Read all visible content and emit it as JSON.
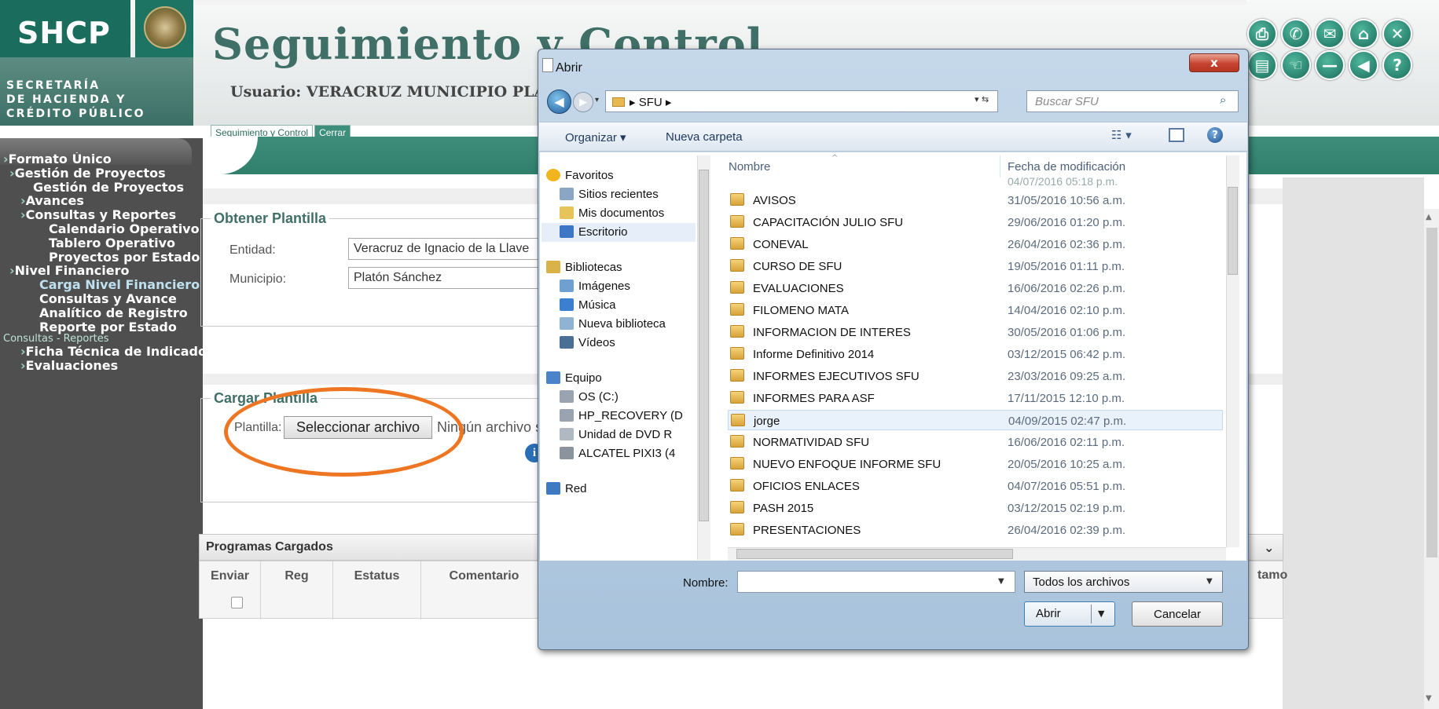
{
  "header": {
    "logo": "SHCP",
    "secretaria": [
      "SECRETARÍA",
      "DE HACIENDA Y",
      "CRÉDITO PÚBLICO"
    ],
    "app_title": "Seguimiento y Control",
    "usuario": "Usuario: VERACRUZ MUNICIPIO PLA",
    "tabs": [
      "Seguimiento y Control",
      "Cerrar"
    ]
  },
  "top_icons_row1": [
    "printer-icon",
    "phone-icon",
    "mail-icon",
    "home-icon",
    "close-icon"
  ],
  "top_icons_row2": [
    "clipboard-icon",
    "hand-pointer-icon",
    "minus-icon",
    "back-icon",
    "help-icon"
  ],
  "sidebar": {
    "items": [
      {
        "label": "Formato Único",
        "level": 1
      },
      {
        "label": "Gestión de Proyectos",
        "level": 2
      },
      {
        "label": "Gestión de Proyectos",
        "level": 3
      },
      {
        "label": "Avances",
        "level": 2
      },
      {
        "label": "Consultas y Reportes",
        "level": 2
      },
      {
        "label": "Calendario Operativo",
        "level": 3
      },
      {
        "label": "Tablero Operativo",
        "level": 3
      },
      {
        "label": "Proyectos por Estado",
        "level": 3
      },
      {
        "label": "Nivel Financiero",
        "level": 1
      },
      {
        "label": "Carga Nivel Financiero",
        "level": 3
      },
      {
        "label": "Consultas y Avance",
        "level": 3
      },
      {
        "label": "Analítico de Registro",
        "level": 3
      },
      {
        "label": "Reporte por Estado",
        "level": 3
      },
      {
        "label": "Consultas - Reportes",
        "level": 0
      },
      {
        "label": "Ficha Técnica de Indicadores",
        "level": 2
      },
      {
        "label": "Evaluaciones",
        "level": 2
      }
    ]
  },
  "obtener": {
    "legend": "Obtener Plantilla",
    "entidad_label": "Entidad:",
    "entidad_value": "Veracruz de Ignacio de la Llave",
    "municipio_label": "Municipio:",
    "municipio_value": "Platón Sánchez"
  },
  "cargar": {
    "legend": "Cargar Plantilla",
    "plantilla_label": "Plantilla:",
    "button": "Seleccionar archivo",
    "no_file": "Ningún archivo seleccionado"
  },
  "grid": {
    "title": "Programas Cargados",
    "columns": [
      "Enviar",
      "Reg",
      "Estatus",
      "Comentario"
    ],
    "last_col": "tamo"
  },
  "dialog": {
    "title": "Abrir",
    "close": "x",
    "address": "SFU",
    "search_placeholder": "Buscar SFU",
    "organize": "Organizar ▾",
    "new_folder": "Nueva carpeta",
    "nav": [
      {
        "label": "Favoritos",
        "icon": "star-icon",
        "group": true
      },
      {
        "label": "Sitios recientes",
        "icon": "recent-places-icon"
      },
      {
        "label": "Mis documentos",
        "icon": "documents-icon"
      },
      {
        "label": "Escritorio",
        "icon": "desktop-icon",
        "selected": true
      },
      {
        "label": "Bibliotecas",
        "icon": "libraries-icon",
        "group": true
      },
      {
        "label": "Imágenes",
        "icon": "pictures-icon"
      },
      {
        "label": "Música",
        "icon": "music-icon"
      },
      {
        "label": "Nueva biblioteca",
        "icon": "library-icon"
      },
      {
        "label": "Vídeos",
        "icon": "videos-icon"
      },
      {
        "label": "Equipo",
        "icon": "computer-icon",
        "group": true
      },
      {
        "label": "OS (C:)",
        "icon": "drive-icon"
      },
      {
        "label": "HP_RECOVERY (D",
        "icon": "drive-icon"
      },
      {
        "label": "Unidad de DVD R",
        "icon": "dvd-icon"
      },
      {
        "label": "ALCATEL PIXI3 (4",
        "icon": "phone-device-icon"
      },
      {
        "label": "Red",
        "icon": "network-icon",
        "group": true
      }
    ],
    "col_name": "Nombre",
    "col_date": "Fecha de modificación",
    "partial_row": "04/07/2016 05:18 p.m.",
    "files": [
      {
        "name": "AVISOS",
        "date": "31/05/2016 10:56 a.m."
      },
      {
        "name": "CAPACITACIÓN JULIO SFU",
        "date": "29/06/2016 01:20 p.m."
      },
      {
        "name": "CONEVAL",
        "date": "26/04/2016 02:36 p.m."
      },
      {
        "name": "CURSO DE SFU",
        "date": "19/05/2016 01:11 p.m."
      },
      {
        "name": "EVALUACIONES",
        "date": "16/06/2016 02:26 p.m."
      },
      {
        "name": "FILOMENO MATA",
        "date": "14/04/2016 02:10 p.m."
      },
      {
        "name": "INFORMACION DE INTERES",
        "date": "30/05/2016 01:06 p.m."
      },
      {
        "name": "Informe Definitivo 2014",
        "date": "03/12/2015 06:42 p.m."
      },
      {
        "name": "INFORMES EJECUTIVOS SFU",
        "date": "23/03/2016 09:25 a.m."
      },
      {
        "name": "INFORMES PARA ASF",
        "date": "17/11/2015 12:10 p.m."
      },
      {
        "name": "jorge",
        "date": "04/09/2015 02:47 p.m.",
        "highlight": true
      },
      {
        "name": "NORMATIVIDAD SFU",
        "date": "16/06/2016 02:11 p.m."
      },
      {
        "name": "NUEVO ENFOQUE INFORME SFU",
        "date": "20/05/2016 10:25 a.m."
      },
      {
        "name": "OFICIOS ENLACES",
        "date": "04/07/2016 05:51 p.m."
      },
      {
        "name": "PASH 2015",
        "date": "03/12/2015 02:19 p.m."
      },
      {
        "name": "PRESENTACIONES",
        "date": "26/04/2016 02:39 p.m."
      }
    ],
    "filename_label": "Nombre:",
    "filename_value": "",
    "filter": "Todos los archivos",
    "open": "Abrir",
    "cancel": "Cancelar"
  },
  "colors": {
    "brand": "#1a6d5c",
    "band": "#3f8e7b",
    "annotation": "#ee7622"
  }
}
